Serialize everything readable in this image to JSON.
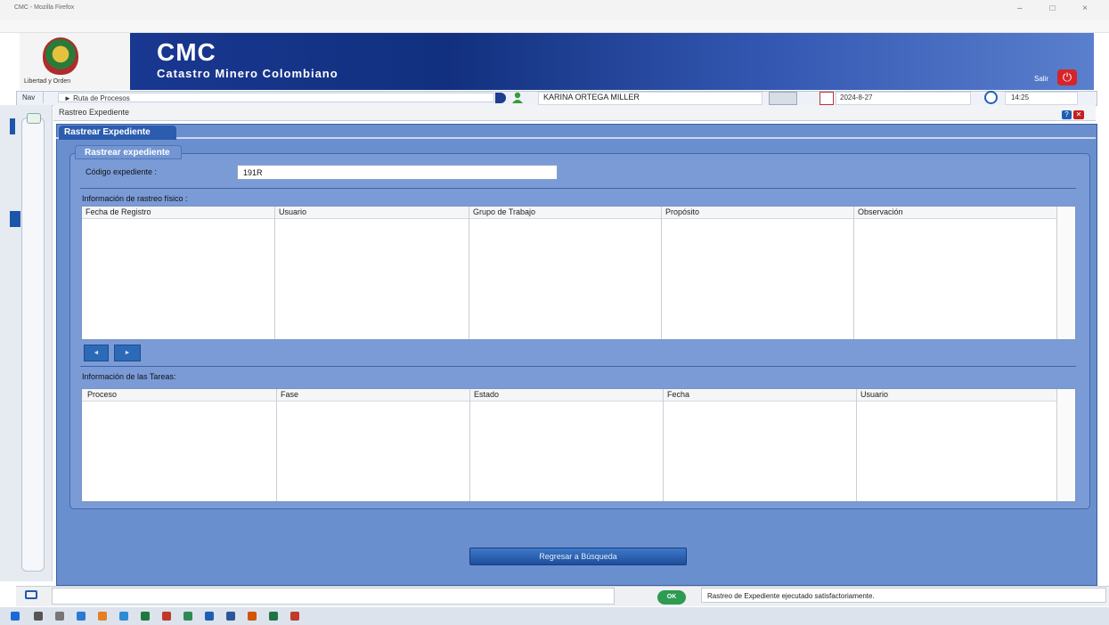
{
  "window": {
    "title": "CMC - Mozilla Firefox",
    "url": "",
    "controls": [
      "–",
      "□",
      "×"
    ]
  },
  "header": {
    "crest_caption": "Libertad y Orden",
    "title": "CMC",
    "subtitle": "Catastro Minero Colombiano",
    "salir_label": "Salir",
    "salir_icon": "power-icon"
  },
  "navbar": {
    "nav_label": "Nav",
    "ruta": "► Ruta de Procesos",
    "user_name": "KARINA ORTEGA MILLER",
    "date": "2024-8-27",
    "time": "14:25"
  },
  "page": {
    "breadcrumb": "Rastreo Expediente",
    "help_label": "?",
    "close_label": "✕",
    "outer_tab": "Rastrear Expediente",
    "inner_tab": "Rastrear expediente",
    "codigo_label": "Código expediente :",
    "codigo_value": "191R"
  },
  "fisico": {
    "section_label": "Información de rastreo físico :",
    "columns": [
      "Fecha de Registro",
      "Usuario",
      "Grupo de Trabajo",
      "Propósito",
      "Observación"
    ],
    "rows": []
  },
  "pager": {
    "prev": "◄",
    "next": "►"
  },
  "tareas": {
    "section_label": "Información de las Tareas:",
    "columns": [
      "Proceso",
      "Fase",
      "Estado",
      "Fecha",
      "Usuario"
    ],
    "rows": []
  },
  "actions": {
    "regresar": "Regresar a Búsqueda"
  },
  "status": {
    "ok_label": "OK",
    "message": "Rastreo de Expediente ejecutado satisfactoriamente."
  },
  "colors": {
    "panel": "#6a8fcf",
    "inner": "#7b9bd7",
    "header": "#1b3a96",
    "tab": "#2c5cae"
  }
}
